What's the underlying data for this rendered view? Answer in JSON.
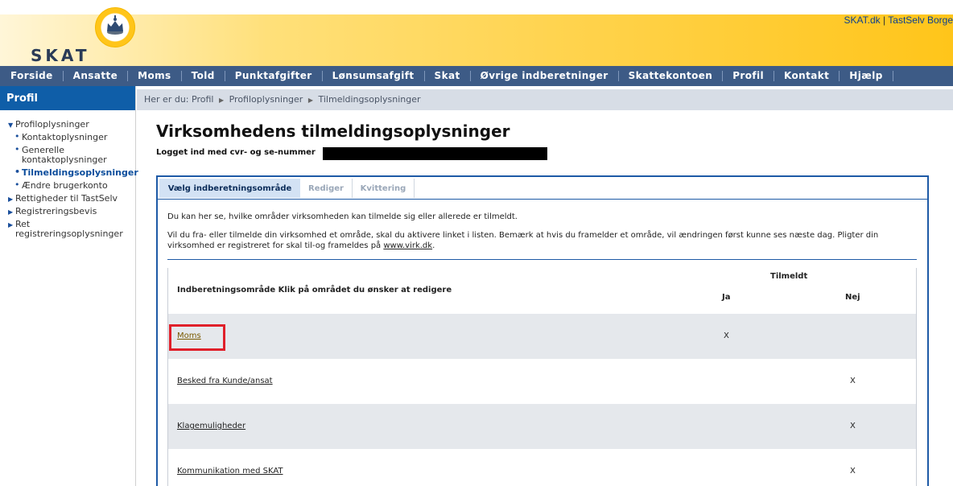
{
  "header": {
    "logo_text": "SKAT",
    "top_links": {
      "skat": "SKAT.dk",
      "separator": "|",
      "tastselv": "TastSelv Borge"
    }
  },
  "mainnav": [
    "Forside",
    "Ansatte",
    "Moms",
    "Told",
    "Punktafgifter",
    "Lønsumsafgift",
    "Skat",
    "Øvrige indberetninger",
    "Skattekontoen",
    "Profil",
    "Kontakt",
    "Hjælp"
  ],
  "sidebar": {
    "title": "Profil",
    "items": [
      {
        "label": "Profiloplysninger",
        "level": 1,
        "expanded": true
      },
      {
        "label": "Kontaktoplysninger",
        "level": 2
      },
      {
        "label": "Generelle kontaktoplysninger",
        "level": 2
      },
      {
        "label": "Tilmeldingsoplysninger",
        "level": 2,
        "active": true
      },
      {
        "label": "Ændre brugerkonto",
        "level": 2
      },
      {
        "label": "Rettigheder til TastSelv",
        "level": 1
      },
      {
        "label": "Registreringsbevis",
        "level": 1
      },
      {
        "label": "Ret registreringsoplysninger",
        "level": 1
      }
    ]
  },
  "breadcrumb": {
    "prefix": "Her er du:",
    "items": [
      "Profil",
      "Profiloplysninger",
      "Tilmeldingsoplysninger"
    ]
  },
  "main": {
    "title": "Virksomhedens tilmeldingsoplysninger",
    "login_label": "Logget ind med cvr- og se-nummer",
    "tabs": [
      {
        "label": "Vælg indberetningsområde",
        "active": true
      },
      {
        "label": "Rediger",
        "active": false
      },
      {
        "label": "Kvittering",
        "active": false
      }
    ],
    "intro_1": "Du kan her se, hvilke områder virksomheden kan tilmelde sig eller allerede er tilmeldt.",
    "intro_2_a": "Vil du fra- eller tilmelde din virksomhed et område, skal du aktivere linket i listen. Bemærk at hvis du framelder et område, vil ændringen først kunne ses næste dag. Pligter din virksomhed er registreret for skal til-og frameldes på",
    "intro_2_link": "www.virk.dk",
    "intro_2_end": ".",
    "table": {
      "header_group": "Tilmeldt",
      "header_area": "Indberetningsområde Klik på området du ønsker at redigere",
      "header_ja": "Ja",
      "header_nej": "Nej",
      "rows": [
        {
          "name": "Moms",
          "ja": "X",
          "nej": ""
        },
        {
          "name": "Besked fra Kunde/ansat",
          "ja": "",
          "nej": "X"
        },
        {
          "name": "Klagemuligheder",
          "ja": "",
          "nej": "X"
        },
        {
          "name": "Kommunikation med SKAT",
          "ja": "",
          "nej": "X"
        }
      ]
    }
  },
  "colors": {
    "nav_bg": "#3d5b86",
    "sidebar_head": "#0f5ea8",
    "panel_border": "#1e5aa6",
    "highlight": "#e0202a",
    "header_yellow": "#ffc51a"
  }
}
